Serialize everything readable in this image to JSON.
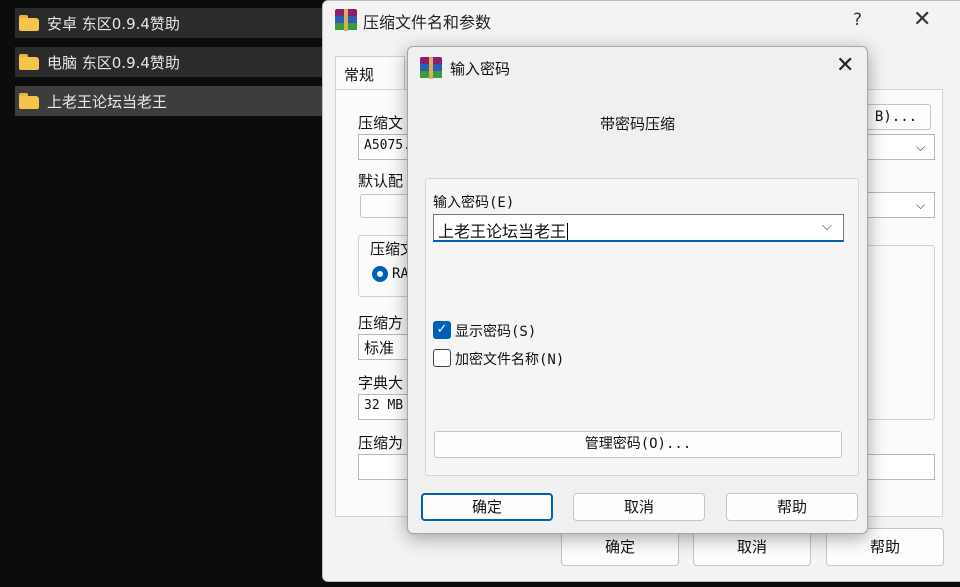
{
  "explorer": {
    "items": [
      {
        "name": "安卓 东区0.9.4赞助"
      },
      {
        "name": "电脑 东区0.9.4赞助"
      },
      {
        "name": "上老王论坛当老王"
      }
    ]
  },
  "main_dialog": {
    "title": "压缩文件名和参数",
    "help_glyph": "?",
    "close_glyph": "✕",
    "tab_general": "常规",
    "archive_name_label": "压缩文",
    "archive_name_value": "A5075.",
    "browse_button": "B)...",
    "default_profile_label": "默认配",
    "format_group_label": "压缩文",
    "format_rar_label": "RA",
    "method_label": "压缩方",
    "method_value": "标准",
    "dict_label": "字典大",
    "dict_value": "32 MB",
    "split_label": "压缩为",
    "ok_label": "确定",
    "cancel_label": "取消",
    "help_label": "帮助"
  },
  "password_dialog": {
    "title": "输入密码",
    "close_glyph": "✕",
    "header": "带密码压缩",
    "password_label": "输入密码(E)",
    "password_value": "上老王论坛当老王",
    "show_password_label": "显示密码(S)",
    "show_password_checked": true,
    "encrypt_names_label": "加密文件名称(N)",
    "encrypt_names_checked": false,
    "manage_button": "管理密码(O)...",
    "ok_label": "确定",
    "cancel_label": "取消",
    "help_label": "帮助"
  },
  "colors": {
    "accent": "#005fb8",
    "folder": "#f3c64b",
    "desktop_bg": "#0c0c0c"
  }
}
